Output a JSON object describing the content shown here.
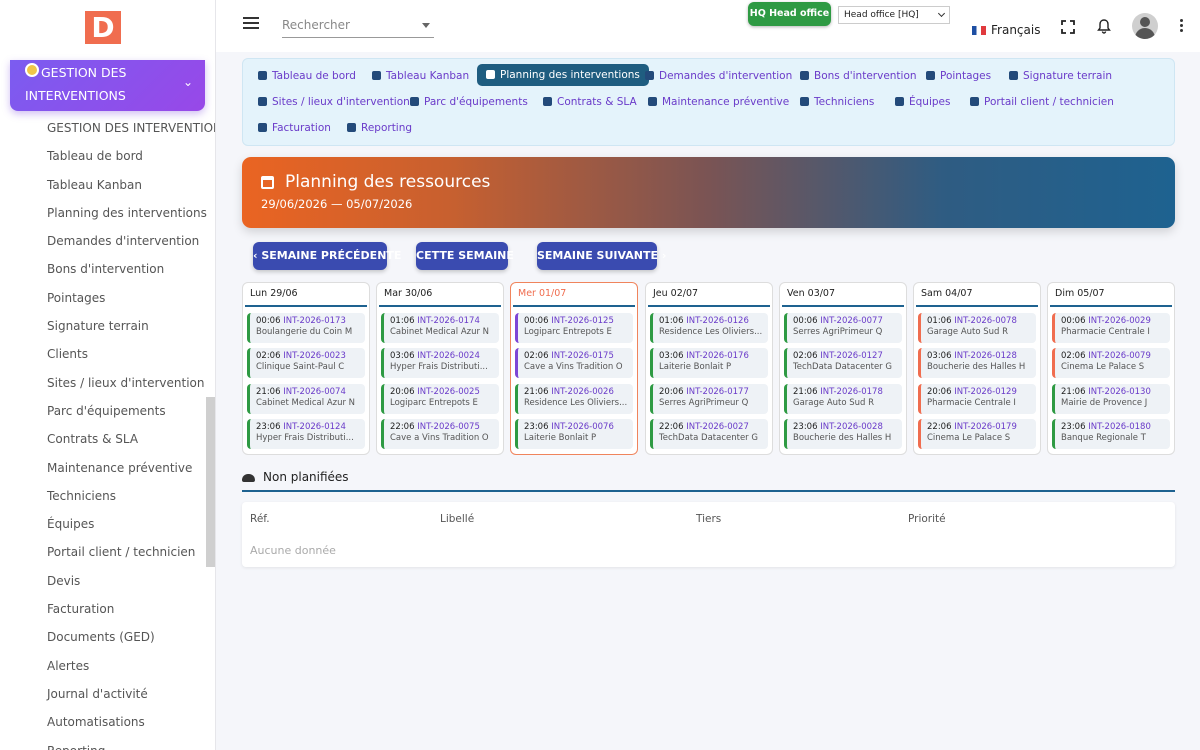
{
  "app": {
    "logo_letter": "D"
  },
  "sidebar": {
    "module_title": "GESTION DES INTERVENTIONS",
    "items": [
      "GESTION DES INTERVENTIONS",
      "Tableau de bord",
      "Tableau Kanban",
      "Planning des interventions",
      "Demandes d'intervention",
      "Bons d'intervention",
      "Pointages",
      "Signature terrain",
      "Clients",
      "Sites / lieux d'intervention",
      "Parc d'équipements",
      "Contrats & SLA",
      "Maintenance préventive",
      "Techniciens",
      "Équipes",
      "Portail client / technicien",
      "Devis",
      "Facturation",
      "Documents (GED)",
      "Alertes",
      "Journal d'activité",
      "Automatisations",
      "Reporting"
    ]
  },
  "topbar": {
    "search_placeholder": "Rechercher",
    "hq_badge": "HQ Head office",
    "entity_selected": "Head office [HQ]",
    "language": "Français"
  },
  "modnav": {
    "items": [
      "Tableau de bord",
      "Tableau Kanban",
      "Planning des interventions",
      "Demandes d'intervention",
      "Bons d'intervention",
      "Pointages",
      "Signature terrain",
      "Sites / lieux d'intervention",
      "Parc d'équipements",
      "Contrats & SLA",
      "Maintenance préventive",
      "Techniciens",
      "Équipes",
      "Portail client / technicien",
      "Facturation",
      "Reporting"
    ],
    "active_index": 2
  },
  "hero": {
    "title": "Planning des ressources",
    "range": "29/06/2026 — 05/07/2026"
  },
  "buttons": {
    "prev": "SEMAINE PRÉCÉDENTE",
    "this": "CETTE SEMAINE",
    "next": "SEMAINE SUIVANTE"
  },
  "colors": {
    "green": "#2e9a43",
    "purple": "#7d46d6",
    "orange": "#f06d4f"
  },
  "week": [
    {
      "label": "Lun 29/06",
      "today": false,
      "events": [
        {
          "time": "00:06",
          "ref": "INT-2026-0173",
          "client": "Boulangerie du Coin M",
          "color": "green"
        },
        {
          "time": "02:06",
          "ref": "INT-2026-0023",
          "client": "Clinique Saint-Paul C",
          "color": "green"
        },
        {
          "time": "21:06",
          "ref": "INT-2026-0074",
          "client": "Cabinet Medical Azur N",
          "color": "green"
        },
        {
          "time": "23:06",
          "ref": "INT-2026-0124",
          "client": "Hyper Frais Distributi...",
          "color": "green"
        }
      ]
    },
    {
      "label": "Mar 30/06",
      "today": false,
      "events": [
        {
          "time": "01:06",
          "ref": "INT-2026-0174",
          "client": "Cabinet Medical Azur N",
          "color": "green"
        },
        {
          "time": "03:06",
          "ref": "INT-2026-0024",
          "client": "Hyper Frais Distributi...",
          "color": "green"
        },
        {
          "time": "20:06",
          "ref": "INT-2026-0025",
          "client": "Logiparc Entrepots E",
          "color": "green"
        },
        {
          "time": "22:06",
          "ref": "INT-2026-0075",
          "client": "Cave a Vins Tradition O",
          "color": "green"
        }
      ]
    },
    {
      "label": "Mer 01/07",
      "today": true,
      "events": [
        {
          "time": "00:06",
          "ref": "INT-2026-0125",
          "client": "Logiparc Entrepots E",
          "color": "purple"
        },
        {
          "time": "02:06",
          "ref": "INT-2026-0175",
          "client": "Cave a Vins Tradition O",
          "color": "purple"
        },
        {
          "time": "21:06",
          "ref": "INT-2026-0026",
          "client": "Residence Les Oliviers...",
          "color": "green"
        },
        {
          "time": "23:06",
          "ref": "INT-2026-0076",
          "client": "Laiterie Bonlait P",
          "color": "green"
        }
      ]
    },
    {
      "label": "Jeu 02/07",
      "today": false,
      "events": [
        {
          "time": "01:06",
          "ref": "INT-2026-0126",
          "client": "Residence Les Oliviers...",
          "color": "green"
        },
        {
          "time": "03:06",
          "ref": "INT-2026-0176",
          "client": "Laiterie Bonlait P",
          "color": "green"
        },
        {
          "time": "20:06",
          "ref": "INT-2026-0177",
          "client": "Serres AgriPrimeur Q",
          "color": "green"
        },
        {
          "time": "22:06",
          "ref": "INT-2026-0027",
          "client": "TechData Datacenter G",
          "color": "green"
        }
      ]
    },
    {
      "label": "Ven 03/07",
      "today": false,
      "events": [
        {
          "time": "00:06",
          "ref": "INT-2026-0077",
          "client": "Serres AgriPrimeur Q",
          "color": "green"
        },
        {
          "time": "02:06",
          "ref": "INT-2026-0127",
          "client": "TechData Datacenter G",
          "color": "green"
        },
        {
          "time": "21:06",
          "ref": "INT-2026-0178",
          "client": "Garage Auto Sud R",
          "color": "green"
        },
        {
          "time": "23:06",
          "ref": "INT-2026-0028",
          "client": "Boucherie des Halles H",
          "color": "green"
        }
      ]
    },
    {
      "label": "Sam 04/07",
      "today": false,
      "events": [
        {
          "time": "01:06",
          "ref": "INT-2026-0078",
          "client": "Garage Auto Sud R",
          "color": "orange"
        },
        {
          "time": "03:06",
          "ref": "INT-2026-0128",
          "client": "Boucherie des Halles H",
          "color": "orange"
        },
        {
          "time": "20:06",
          "ref": "INT-2026-0129",
          "client": "Pharmacie Centrale I",
          "color": "orange"
        },
        {
          "time": "22:06",
          "ref": "INT-2026-0179",
          "client": "Cinema Le Palace S",
          "color": "orange"
        }
      ]
    },
    {
      "label": "Dim 05/07",
      "today": false,
      "events": [
        {
          "time": "00:06",
          "ref": "INT-2026-0029",
          "client": "Pharmacie Centrale I",
          "color": "orange"
        },
        {
          "time": "02:06",
          "ref": "INT-2026-0079",
          "client": "Cinema Le Palace S",
          "color": "orange"
        },
        {
          "time": "21:06",
          "ref": "INT-2026-0130",
          "client": "Mairie de Provence J",
          "color": "green"
        },
        {
          "time": "23:06",
          "ref": "INT-2026-0180",
          "client": "Banque Regionale T",
          "color": "green"
        }
      ]
    }
  ],
  "unplanned": {
    "title": "Non planifiées",
    "columns": [
      "Réf.",
      "Libellé",
      "Tiers",
      "Priorité"
    ],
    "empty": "Aucune donnée"
  }
}
